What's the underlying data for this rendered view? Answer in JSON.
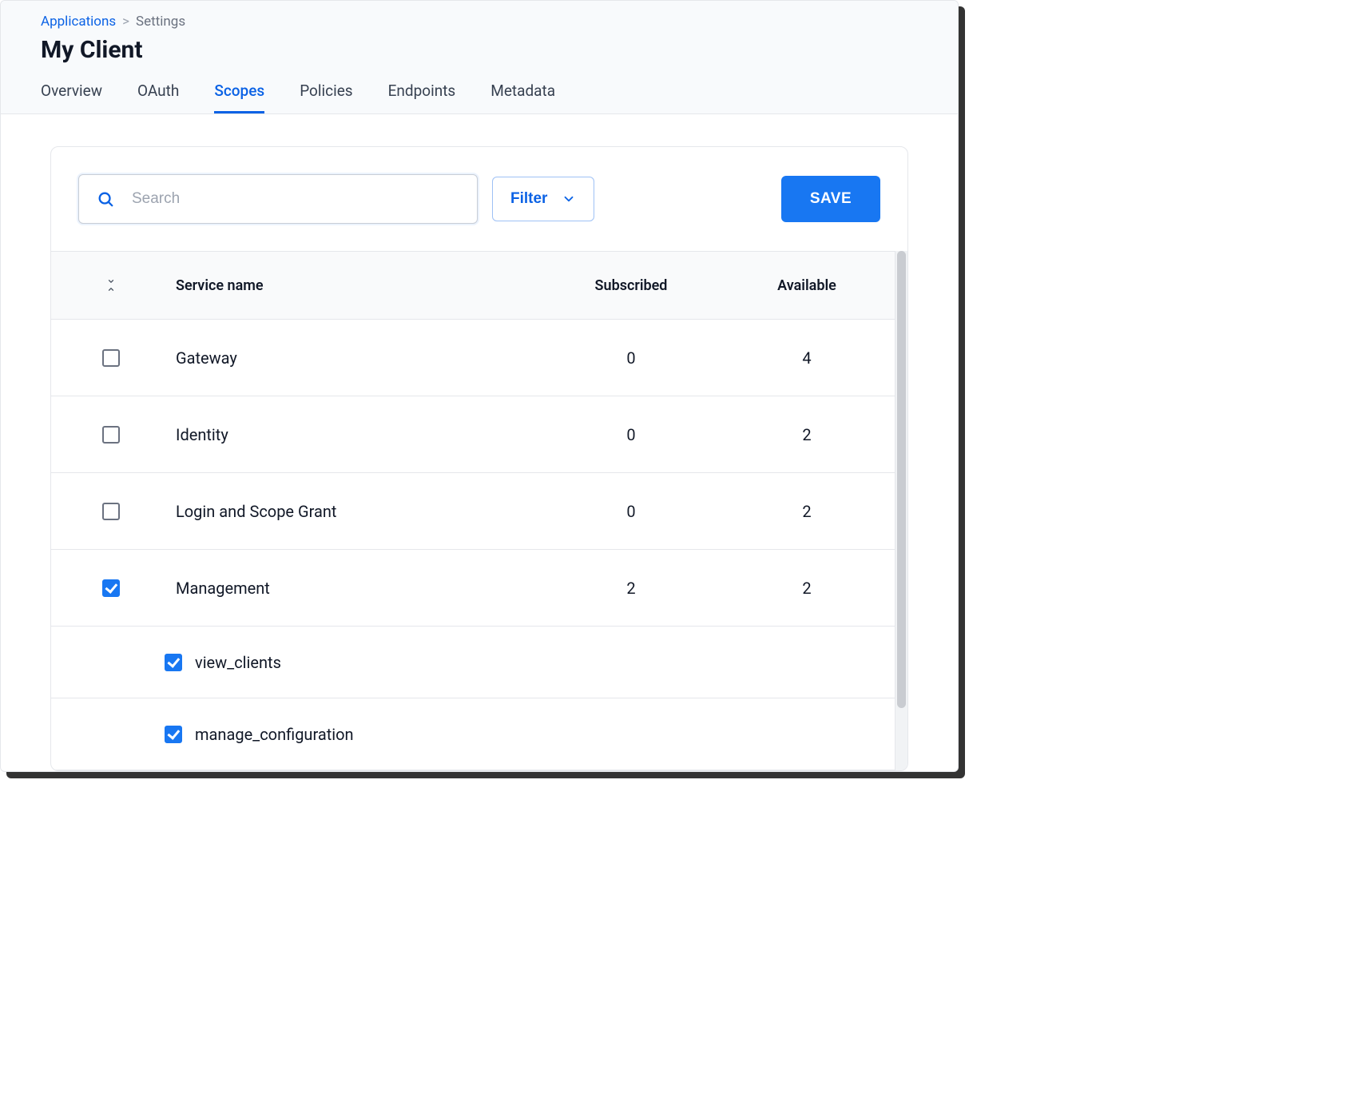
{
  "breadcrumb": {
    "root": "Applications",
    "current": "Settings"
  },
  "page_title": "My Client",
  "tabs": [
    {
      "label": "Overview",
      "active": false
    },
    {
      "label": "OAuth",
      "active": false
    },
    {
      "label": "Scopes",
      "active": true
    },
    {
      "label": "Policies",
      "active": false
    },
    {
      "label": "Endpoints",
      "active": false
    },
    {
      "label": "Metadata",
      "active": false
    }
  ],
  "toolbar": {
    "search_placeholder": "Search",
    "filter_label": "Filter",
    "save_label": "SAVE"
  },
  "columns": {
    "service_name": "Service name",
    "subscribed": "Subscribed",
    "available": "Available"
  },
  "services": [
    {
      "name": "Gateway",
      "subscribed": 0,
      "available": 4,
      "checked": false
    },
    {
      "name": "Identity",
      "subscribed": 0,
      "available": 2,
      "checked": false
    },
    {
      "name": "Login and Scope Grant",
      "subscribed": 0,
      "available": 2,
      "checked": false
    },
    {
      "name": "Management",
      "subscribed": 2,
      "available": 2,
      "checked": true,
      "scopes": [
        {
          "name": "view_clients",
          "checked": true
        },
        {
          "name": "manage_configuration",
          "checked": true
        }
      ]
    }
  ]
}
